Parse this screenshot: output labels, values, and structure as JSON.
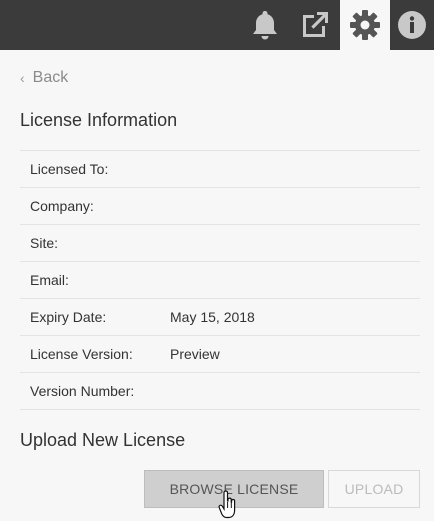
{
  "header": {
    "icons": [
      "bell-icon",
      "external-link-icon",
      "gear-icon",
      "info-icon"
    ],
    "active_icon": "gear-icon",
    "colors": {
      "bar": "#3b3b3b",
      "icon": "#c8c8c8",
      "active_icon": "#555555"
    }
  },
  "back_link": {
    "label": "Back"
  },
  "license_info": {
    "title": "License Information",
    "rows": [
      {
        "label": "Licensed To:",
        "value": ""
      },
      {
        "label": "Company:",
        "value": ""
      },
      {
        "label": "Site:",
        "value": ""
      },
      {
        "label": "Email:",
        "value": ""
      },
      {
        "label": "Expiry Date:",
        "value": "May 15, 2018"
      },
      {
        "label": "License Version:",
        "value": "Preview"
      },
      {
        "label": "Version Number:",
        "value": ""
      }
    ]
  },
  "upload_section": {
    "title": "Upload New License",
    "browse_label": "BROWSE LICENSE",
    "upload_label": "UPLOAD",
    "upload_disabled": true
  }
}
